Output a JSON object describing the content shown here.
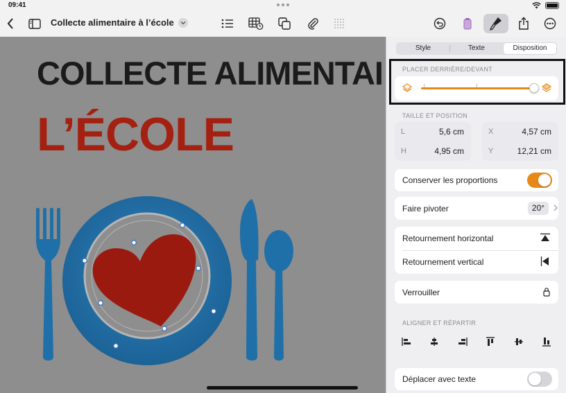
{
  "status": {
    "time": "09:41"
  },
  "toolbar": {
    "document_title": "Collecte alimentaire à l’école",
    "icons": [
      "back-icon",
      "sidebar-icon",
      "list-icon",
      "table-icon",
      "shapes-icon",
      "attachment-icon",
      "grid-icon",
      "undo-icon",
      "document-icon",
      "format-brush-icon",
      "share-icon",
      "more-icon"
    ]
  },
  "canvas": {
    "heading_line1": "COLLECTE ALIMENTAI",
    "heading_line2": "L’ÉCOLE"
  },
  "inspector": {
    "tabs": [
      {
        "label": "Style",
        "active": false
      },
      {
        "label": "Texte",
        "active": false
      },
      {
        "label": "Disposition",
        "active": true
      }
    ],
    "layer": {
      "label": "PLACER DERRIÈRE/DEVANT",
      "position": 1.0
    },
    "size_position": {
      "label": "TAILLE ET POSITION",
      "width": {
        "key": "L",
        "value": "5,6 cm"
      },
      "height": {
        "key": "H",
        "value": "4,95 cm"
      },
      "x": {
        "key": "X",
        "value": "4,57 cm"
      },
      "y": {
        "key": "Y",
        "value": "12,21 cm"
      }
    },
    "constrain": {
      "label": "Conserver les proportions",
      "on": true
    },
    "rotate": {
      "label": "Faire pivoter",
      "value": "20°"
    },
    "flip_horizontal": {
      "label": "Retournement horizontal"
    },
    "flip_vertical": {
      "label": "Retournement vertical"
    },
    "lock": {
      "label": "Verrouiller"
    },
    "align": {
      "label": "ALIGNER ET RÉPARTIR",
      "buttons": [
        "align-left-icon",
        "align-center-icon",
        "align-right-icon",
        "align-top-icon",
        "align-middle-icon",
        "align-bottom-icon"
      ]
    },
    "move_with_text": {
      "label": "Déplacer avec texte",
      "on": false
    }
  },
  "colors": {
    "accent": "#e58a18",
    "heading_red": "#a42112",
    "plate_blue": "#1f6fa8",
    "heart_red": "#9b1a10"
  }
}
